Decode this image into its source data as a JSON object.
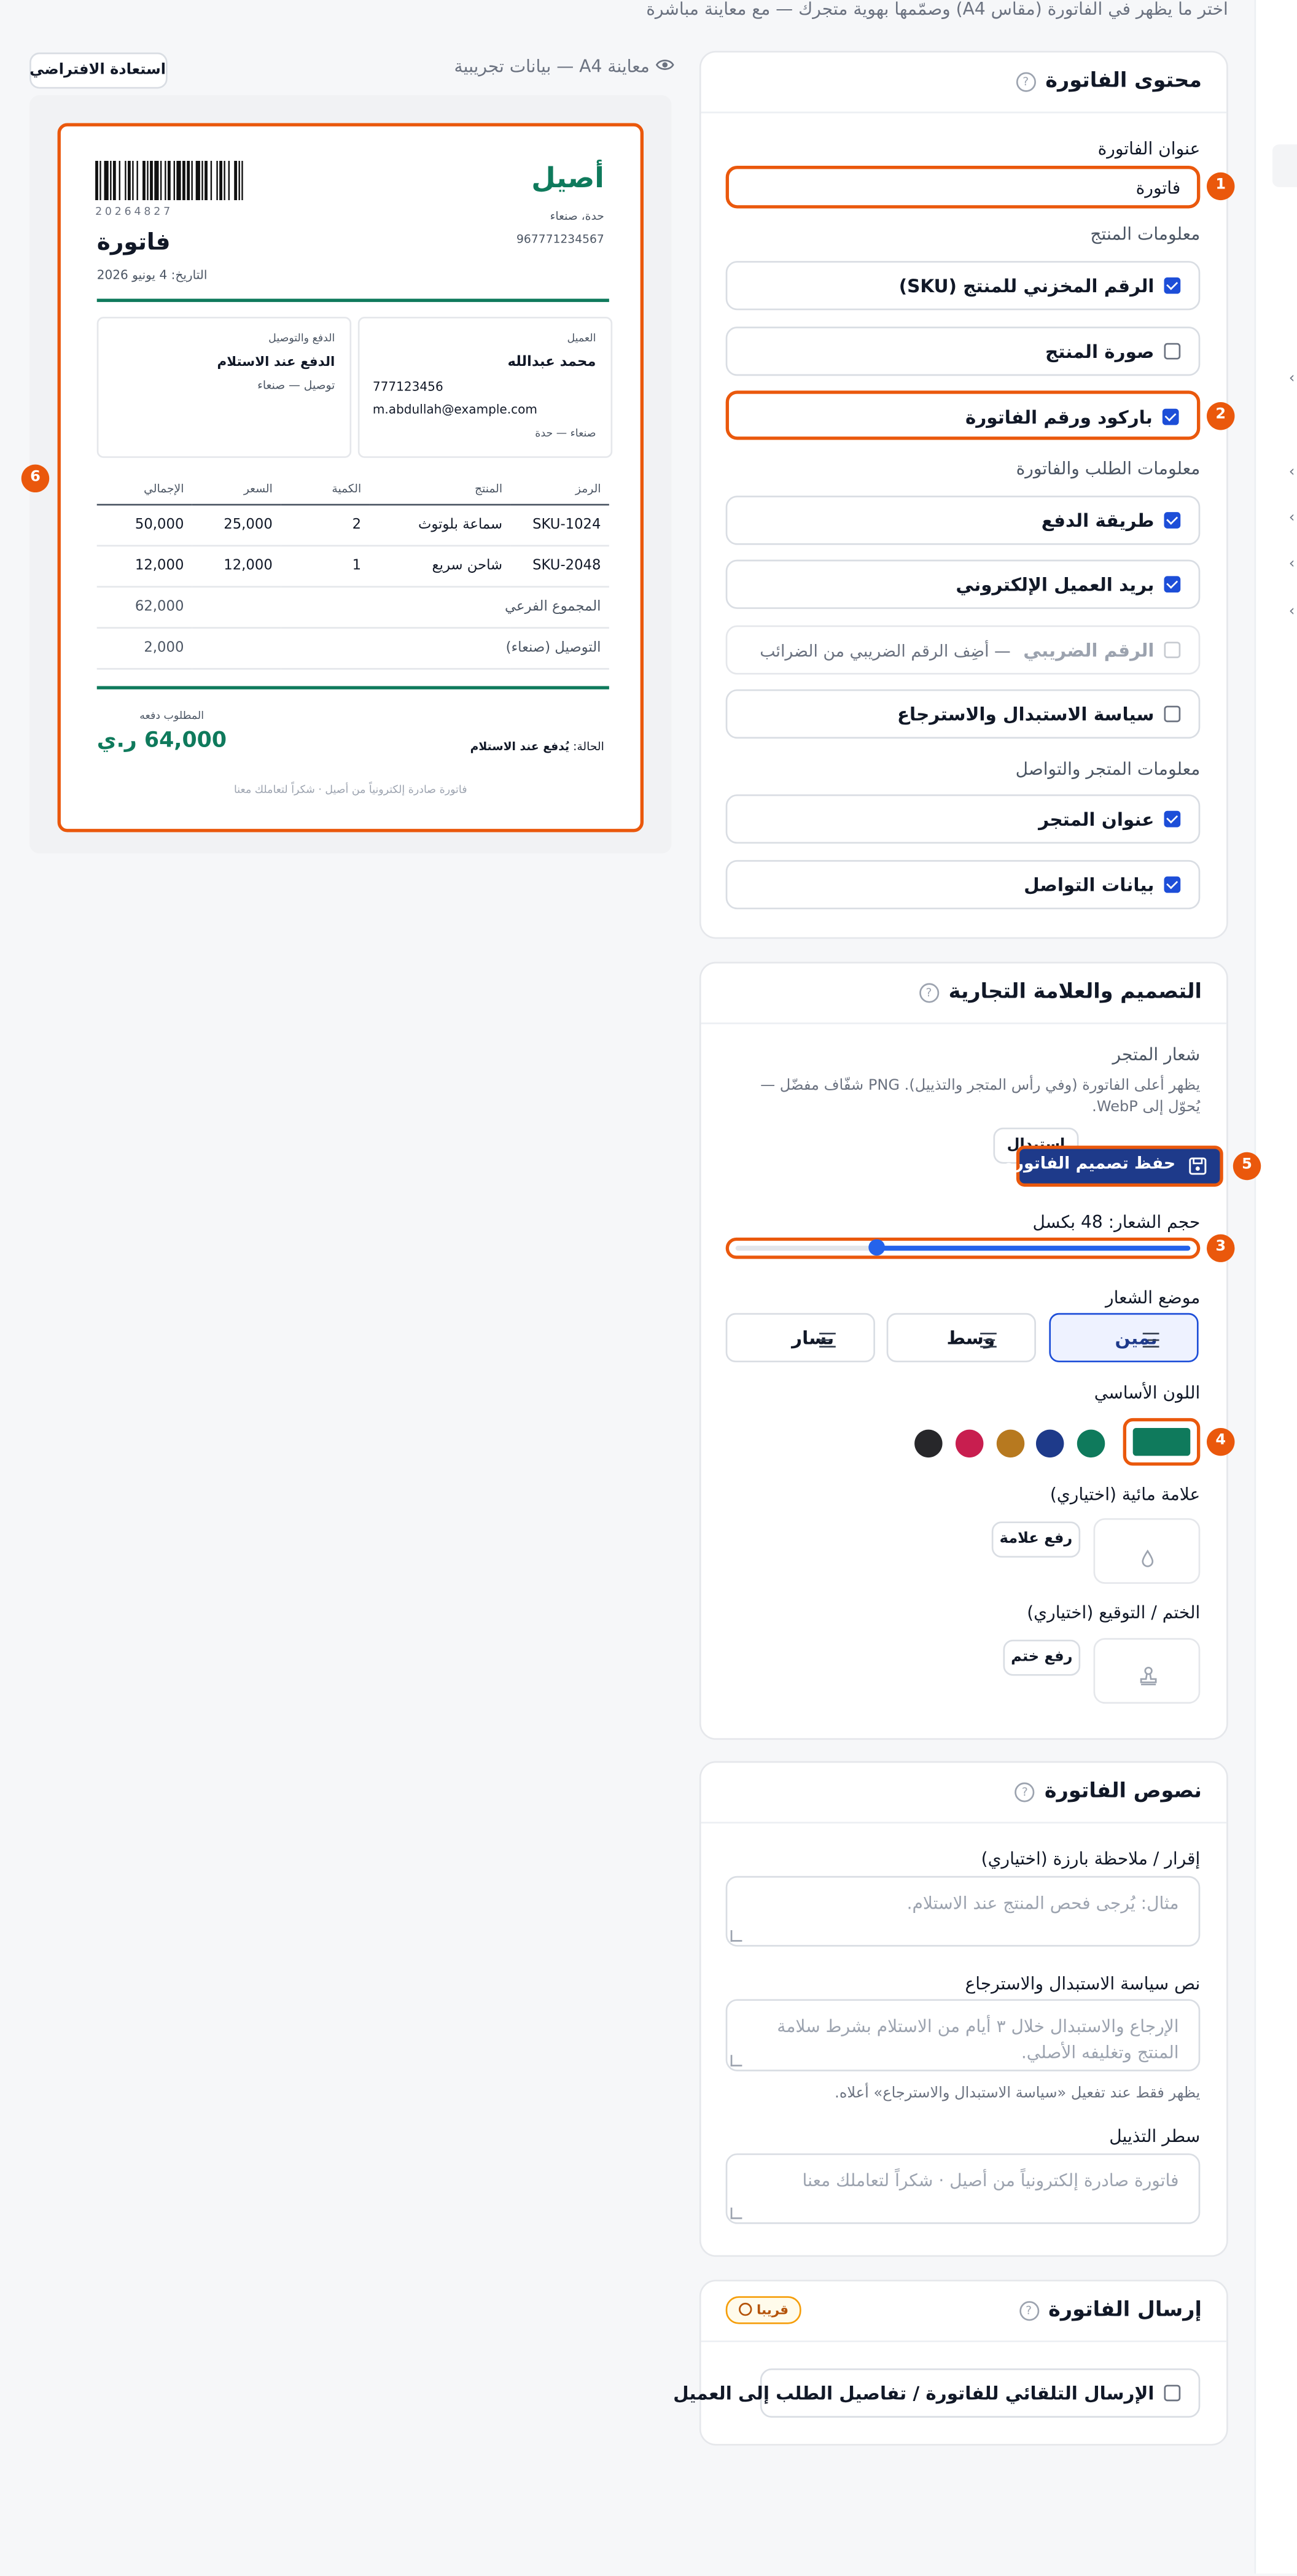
{
  "top_hint": "اختر ما يظهر في الفاتورة (مقاس A4) وصمّمها بهوية متجرك — مع معاينة مباشرة",
  "preview": {
    "heading": "معاينة A4 — بيانات تجريبية",
    "restore_label": "استعادة الافتراضي",
    "invoice": {
      "store_name": "أصيل",
      "store_city": "حدة، صنعاء",
      "store_phone": "967771234567",
      "barcode_number": "20264827",
      "title": "فاتورة",
      "date": "التاريخ: 4 يونيو 2026",
      "customer_label": "العميل",
      "customer_name": "محمد عبدالله",
      "customer_phone": "777123456",
      "customer_email": "m.abdullah@example.com",
      "customer_address": "صنعاء — حدة",
      "payment_label": "الدفع والتوصيل",
      "payment_method": "الدفع عند الاستلام",
      "delivery": "توصيل — صنعاء",
      "columns": [
        "الرمز",
        "المنتج",
        "الكمية",
        "السعر",
        "الإجمالي"
      ],
      "rows": [
        {
          "sku": "SKU-1024",
          "product": "سماعة بلوتوث",
          "qty": "2",
          "price": "25,000",
          "total": "50,000"
        },
        {
          "sku": "SKU-2048",
          "product": "شاحن سريع",
          "qty": "1",
          "price": "12,000",
          "total": "12,000"
        }
      ],
      "subtotal_label": "المجموع الفرعي",
      "subtotal_value": "62,000",
      "delivery_fee_label": "التوصيل (صنعاء)",
      "delivery_fee_value": "2,000",
      "due_label": "المطلوب دفعه",
      "due_value": "64,000 ر.ي",
      "status_label": "الحالة:",
      "status_value": "يُدفع عند الاستلام",
      "footer": "فاتورة صادرة إلكترونياً من أصيل · شكراً لتعاملك معنا"
    }
  },
  "content_card": {
    "title": "محتوى الفاتورة",
    "invoice_title_label": "عنوان الفاتورة",
    "invoice_title_value": "فاتورة",
    "product_section": "معلومات المنتج",
    "product_options": [
      {
        "label": "الرقم المخزني للمنتج (SKU)",
        "checked": true
      },
      {
        "label": "صورة المنتج",
        "checked": false
      },
      {
        "label": "باركود ورقم الفاتورة",
        "checked": true
      }
    ],
    "order_section": "معلومات الطلب والفاتورة",
    "order_options": [
      {
        "label": "طريقة الدفع",
        "checked": true
      },
      {
        "label": "بريد العميل الإلكتروني",
        "checked": true
      }
    ],
    "tax_label": "الرقم الضريبي",
    "tax_hint": "— أضِف الرقم الضريبي من الضرائب",
    "return_policy_label": "سياسة الاستبدال والاسترجاع",
    "store_section": "معلومات المتجر والتواصل",
    "store_options": [
      {
        "label": "عنوان المتجر",
        "checked": true
      },
      {
        "label": "بيانات التواصل",
        "checked": true
      }
    ]
  },
  "design_card": {
    "title": "التصميم والعلامة التجارية",
    "logo_label": "شعار المتجر",
    "logo_hint": "يظهر أعلى الفاتورة (وفي رأس المتجر والتذييل). PNG شفّاف مفضّل — يُحوّل إلى WebP.",
    "logo_upload_partial": "استبدال",
    "save_label": "حفظ تصميم الفاتورة",
    "logo_size_label": "حجم الشعار: 48 بكسل",
    "logo_size_fraction": 0.31,
    "logo_position_label": "موضع الشعار",
    "positions": [
      "يمين",
      "وسط",
      "يسار"
    ],
    "primary_color_label": "اللون الأساسي",
    "primary_color": "#0f7a5c",
    "swatches": [
      "#0f7a5c",
      "#1e3a8a",
      "#b7791f",
      "#c81e4f",
      "#27272a"
    ],
    "watermark_label": "علامة مائية (اختياري)",
    "watermark_button": "رفع علامة",
    "stamp_label": "الختم / التوقيع (اختياري)",
    "stamp_button": "رفع ختم"
  },
  "texts_card": {
    "title": "نصوص الفاتورة",
    "declaration_label": "إقرار / ملاحظة بارزة (اختياري)",
    "declaration_placeholder": "مثال: يُرجى فحص المنتج عند الاستلام.",
    "policy_label": "نص سياسة الاستبدال والاسترجاع",
    "policy_placeholder": "الإرجاع والاستبدال خلال ٣ أيام من الاستلام بشرط سلامة المنتج وتغليفه الأصلي.",
    "policy_hint": "يظهر فقط عند تفعيل «سياسة الاستبدال والاسترجاع» أعلاه.",
    "footer_label": "سطر التذييل",
    "footer_placeholder": "فاتورة صادرة إلكترونياً من أصيل · شكراً لتعاملك معنا"
  },
  "send_card": {
    "title": "إرسال الفاتورة",
    "soon_badge": "قريبا",
    "auto_send_label": "الإرسال التلقائي للفاتورة / تفاصيل الطلب إلى العميل"
  },
  "markers": [
    "1",
    "2",
    "3",
    "4",
    "5",
    "6"
  ]
}
